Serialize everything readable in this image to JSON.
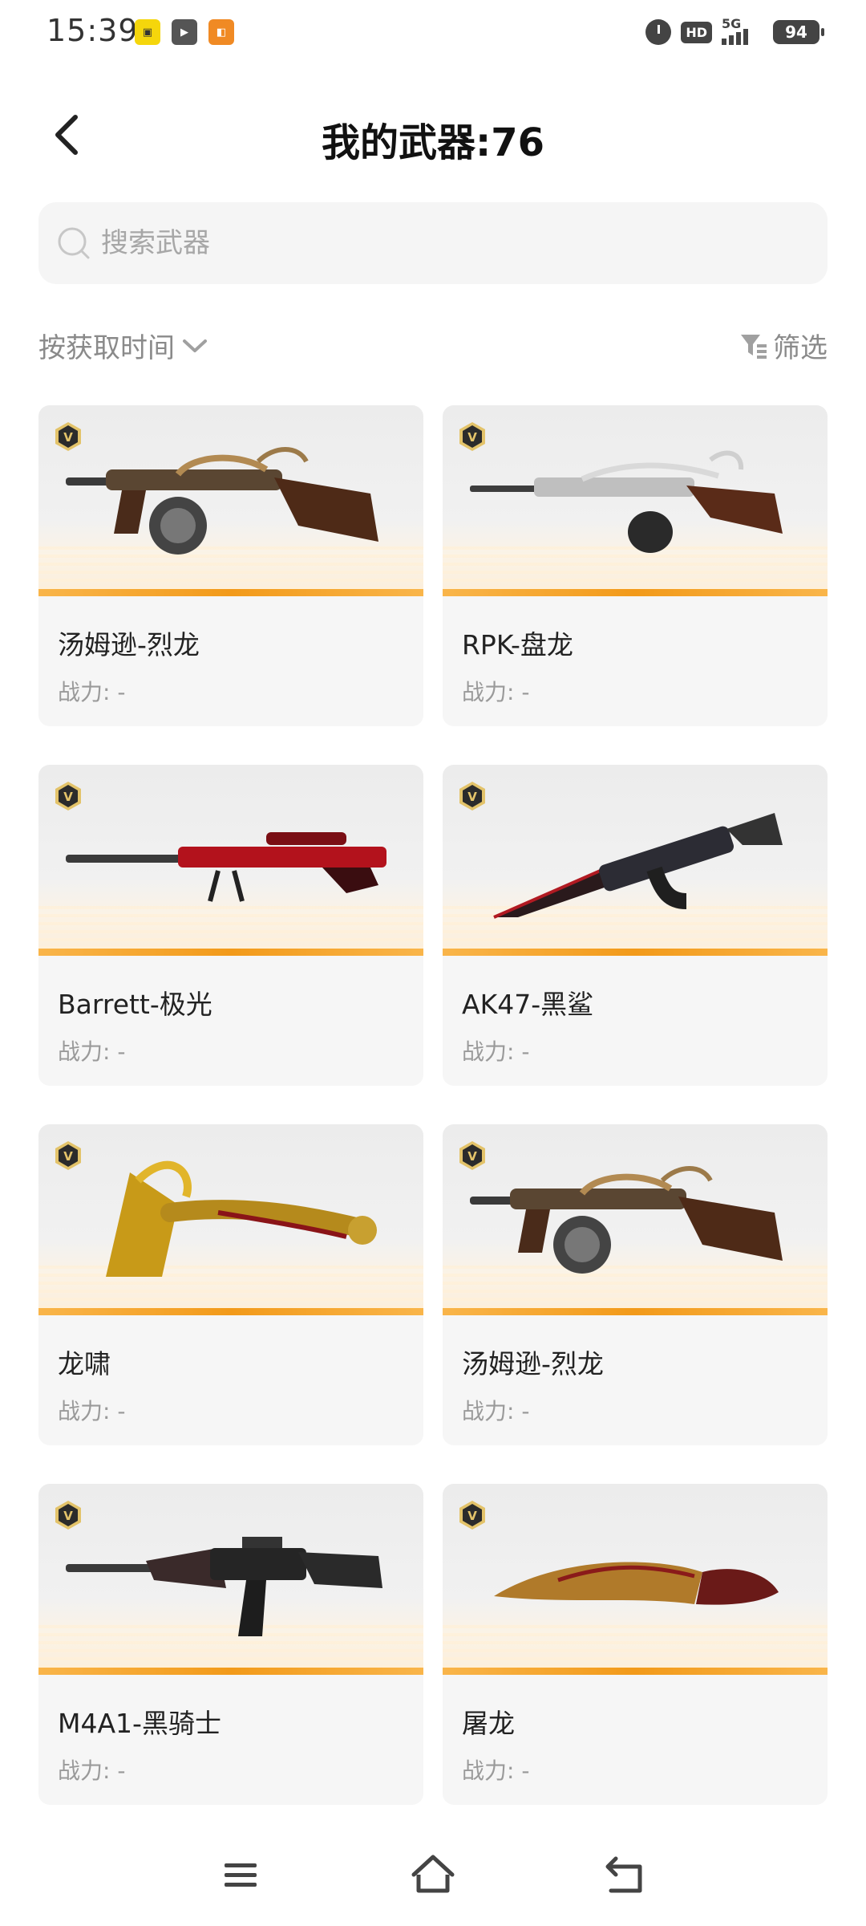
{
  "status_bar": {
    "time": "15:39",
    "app_icons": [
      "yellow-app-icon",
      "video-app-icon",
      "taobao-app-icon"
    ],
    "hd": "HD",
    "network": "5G",
    "battery": "94"
  },
  "header": {
    "title": "我的武器:76"
  },
  "search": {
    "placeholder": "搜索武器"
  },
  "sort": {
    "label": "按获取时间"
  },
  "filter": {
    "label": "筛选"
  },
  "weapons": [
    {
      "name": "汤姆逊-烈龙",
      "power": "战力: -",
      "icon": "tommy-gun-dragon"
    },
    {
      "name": "RPK-盘龙",
      "power": "战力: -",
      "icon": "rpk-dragon"
    },
    {
      "name": "Barrett-极光",
      "power": "战力: -",
      "icon": "sniper-red"
    },
    {
      "name": "AK47-黑鲨",
      "power": "战力: -",
      "icon": "ak47-shark"
    },
    {
      "name": "龙啸",
      "power": "战力: -",
      "icon": "golden-dragon-axe"
    },
    {
      "name": "汤姆逊-烈龙",
      "power": "战力: -",
      "icon": "tommy-gun-dragon"
    },
    {
      "name": "M4A1-黑骑士",
      "power": "战力: -",
      "icon": "m4a1-black-knight"
    },
    {
      "name": "屠龙",
      "power": "战力: -",
      "icon": "dragon-blade"
    }
  ],
  "colors": {
    "accent_orange": "#f29a1a",
    "badge_gold": "#e3c36a",
    "text_gray": "#8a8a8a"
  }
}
